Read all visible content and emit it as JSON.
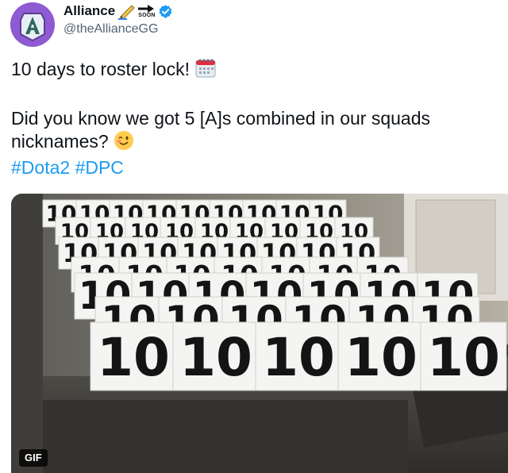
{
  "tweet": {
    "author": {
      "display_name": "Alliance",
      "handle": "@theAllianceGG",
      "verified": true,
      "name_emoji_text": "SOON"
    },
    "lines": {
      "line1": "10 days to roster lock!",
      "line2": "Did you know we got 5 [A]s combined in our squads nicknames?",
      "hashtag1": "#Dota2",
      "hashtag2": "#DPC"
    },
    "media": {
      "badge": "GIF",
      "sign_text": "10"
    }
  },
  "colors": {
    "text": "#0f1419",
    "secondary": "#536471",
    "link": "#1d9bf0",
    "verified": "#1d9bf0",
    "avatar_bg": "#8e5bd3"
  },
  "icons": {
    "verified": "verified-badge-icon",
    "calendar": "calendar-emoji-icon",
    "wink": "winking-face-emoji-icon",
    "soon": "soon-arrow-emoji-icon",
    "pen": "pen-emoji-icon"
  }
}
